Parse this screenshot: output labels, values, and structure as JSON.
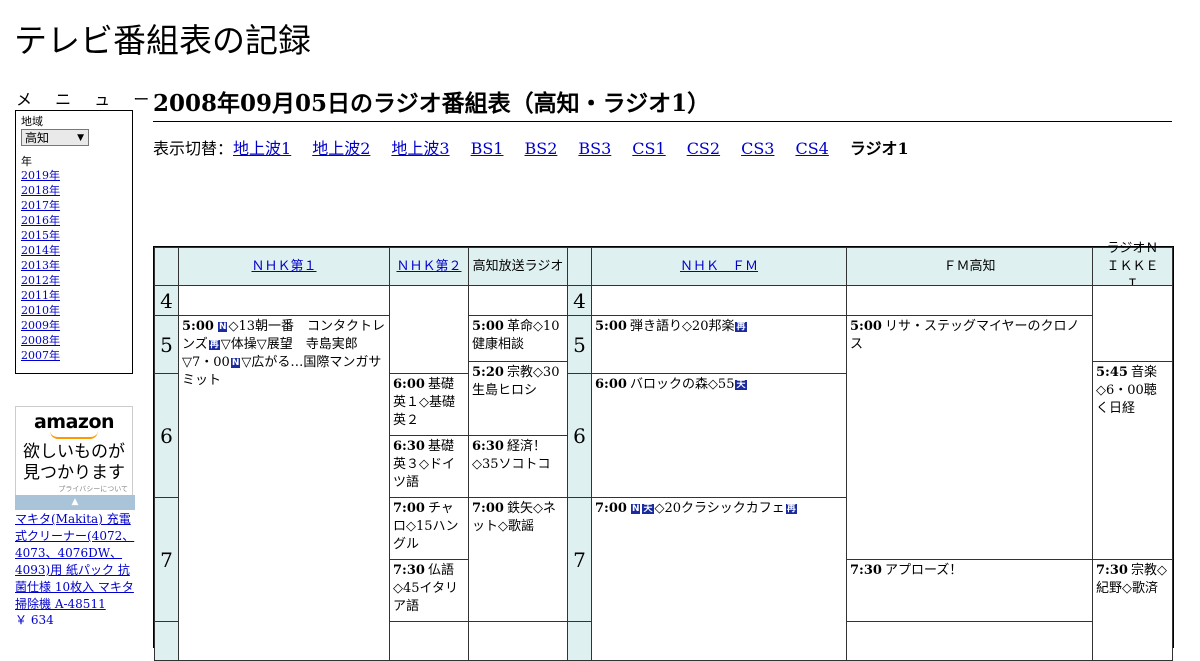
{
  "site": {
    "title": "テレビ番組表の記録"
  },
  "menu": {
    "label": "メ ニ ュ ー",
    "region_label": "地域",
    "region_value": "高知",
    "year_label": "年",
    "years": [
      "2019年",
      "2018年",
      "2017年",
      "2016年",
      "2015年",
      "2014年",
      "2013年",
      "2012年",
      "2011年",
      "2010年",
      "2009年",
      "2008年",
      "2007年"
    ]
  },
  "ad": {
    "logo": "amazon",
    "tagline_1": "欲しいものが",
    "tagline_2": "見つかります",
    "privacy": "プライバシーについて",
    "product": "マキタ(Makita) 充電式クリーナー(4072、4073、4076DW、4093)用 紙パック 抗菌仕様 10枚入 マキタ 掃除機 A-48511",
    "price": "￥ 634"
  },
  "page": {
    "title": "2008年09月05日のラジオ番組表（高知・ラジオ1）"
  },
  "switcher": {
    "label": "表示切替：",
    "items": [
      "地上波1",
      "地上波2",
      "地上波3",
      "BS1",
      "BS2",
      "BS3",
      "CS1",
      "CS2",
      "CS3",
      "CS4"
    ],
    "current": "ラジオ1"
  },
  "guide": {
    "channels": [
      "ＮＨＫ第１",
      "ＮＨＫ第２",
      "高知放送ラジオ",
      "ＮＨＫ　ＦＭ",
      "ＦＭ高知",
      "ラジオＮＩＫＫＥＩ"
    ],
    "hours": [
      "4",
      "5",
      "6",
      "7"
    ],
    "programs": {
      "nhk1_500": {
        "time": "5:00",
        "b1": "N",
        "a": "◇13朝一番　コンタクトレンズ",
        "b2": "再",
        "b": "▽体操▽展望　寺島実郎▽7・00",
        "b3": "N",
        "c": "▽広がる…国際マンガサミット"
      },
      "nhk2_600": {
        "time": "6:00",
        "text": "基礎英１◇基礎英２"
      },
      "nhk2_630": {
        "time": "6:30",
        "text": "基礎英３◇ドイツ語"
      },
      "nhk2_700": {
        "time": "7:00",
        "text": "チャロ◇15ハングル"
      },
      "nhk2_730": {
        "time": "7:30",
        "text": "仏語◇45イタリア語"
      },
      "kochi_500": {
        "time": "5:00",
        "text": "革命◇10健康相談"
      },
      "kochi_520": {
        "time": "5:20",
        "text": "宗教◇30生島ヒロシ"
      },
      "kochi_630": {
        "time": "6:30",
        "text": "経済！◇35ソコトコ"
      },
      "kochi_700": {
        "time": "7:00",
        "text": "鉄矢◇ネット◇歌謡"
      },
      "fm_500": {
        "time": "5:00",
        "text": "弾き語り◇20邦楽",
        "b1": "再"
      },
      "fm_600": {
        "time": "6:00",
        "text": "バロックの森◇55",
        "b1": "天"
      },
      "fm_700": {
        "time": "7:00",
        "b1": "N",
        "b2": "天",
        "text": "◇20クラシックカフェ",
        "b3": "再"
      },
      "fmkochi_500": {
        "time": "5:00",
        "text": "リサ・ステッグマイヤーのクロノス"
      },
      "fmkochi_730": {
        "time": "7:30",
        "text": "アプローズ！"
      },
      "nikkei_545": {
        "time": "5:45",
        "text": "音楽◇6・00聴く日経"
      },
      "nikkei_730": {
        "time": "7:30",
        "text": "宗教◇紀野◇歌済"
      }
    }
  },
  "colors": {
    "header_bg": "#dff0f0",
    "badge": "#1a2aa0",
    "link": "#0000cc"
  }
}
